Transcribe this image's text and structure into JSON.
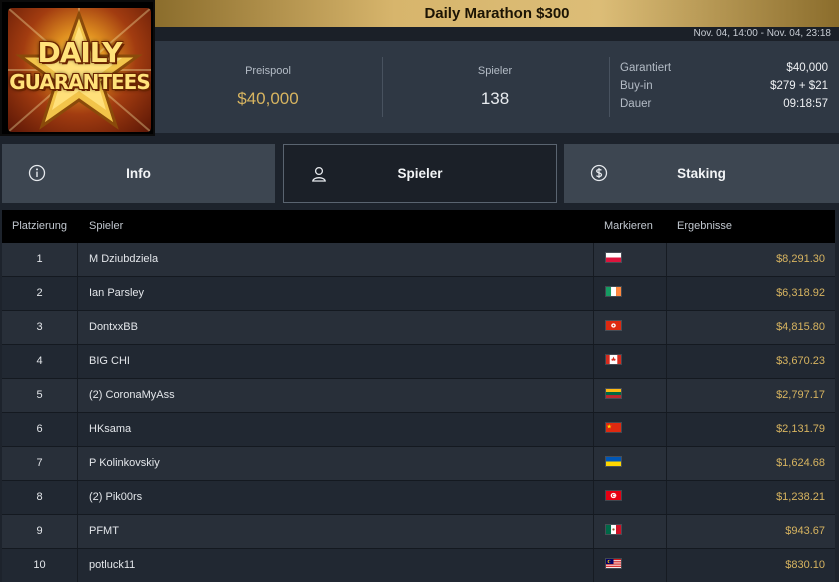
{
  "logo": {
    "line1": "DAILY",
    "line2": "GUARANTEES"
  },
  "header": {
    "title": "Daily Marathon $300",
    "date_range": "Nov. 04, 14:00 - Nov. 04, 23:18"
  },
  "stats": {
    "prize_label": "Preispool",
    "prize_value": "$40,000",
    "players_label": "Spieler",
    "players_value": "138",
    "guaranteed_label": "Garantiert",
    "guaranteed_value": "$40,000",
    "buyin_label": "Buy-in",
    "buyin_value": "$279 + $21",
    "duration_label": "Dauer",
    "duration_value": "09:18:57"
  },
  "tabs": [
    {
      "label": "Info",
      "icon": "info-icon"
    },
    {
      "label": "Spieler",
      "icon": "user-icon",
      "active": true
    },
    {
      "label": "Staking",
      "icon": "dollar-coin-icon"
    }
  ],
  "table": {
    "headers": {
      "rank": "Platzierung",
      "player": "Spieler",
      "flag": "Markieren",
      "result": "Ergebnisse"
    },
    "rows": [
      {
        "rank": "1",
        "name": "M Dziubdziela",
        "flag": "poland",
        "result": "$8,291.30"
      },
      {
        "rank": "2",
        "name": "Ian Parsley",
        "flag": "ireland",
        "result": "$6,318.92"
      },
      {
        "rank": "3",
        "name": "DontxxBB",
        "flag": "hong-kong",
        "result": "$4,815.80"
      },
      {
        "rank": "4",
        "name": "BIG CHI",
        "flag": "canada",
        "result": "$3,670.23"
      },
      {
        "rank": "5",
        "name": "(2) CoronaMyAss",
        "flag": "lithuania",
        "result": "$2,797.17"
      },
      {
        "rank": "6",
        "name": "HKsama",
        "flag": "china",
        "result": "$2,131.79"
      },
      {
        "rank": "7",
        "name": "P Kolinkovskiy",
        "flag": "ukraine",
        "result": "$1,624.68"
      },
      {
        "rank": "8",
        "name": "(2) Pik00rs",
        "flag": "tunisia",
        "result": "$1,238.21"
      },
      {
        "rank": "9",
        "name": "PFMT",
        "flag": "mexico",
        "result": "$943.67"
      },
      {
        "rank": "10",
        "name": "potluck11",
        "flag": "malaysia",
        "result": "$830.10"
      }
    ]
  },
  "colors": {
    "gold": "#d7b460",
    "background": "#1d232c",
    "tab": "#3d4651",
    "tab_active": "#1b2028"
  }
}
